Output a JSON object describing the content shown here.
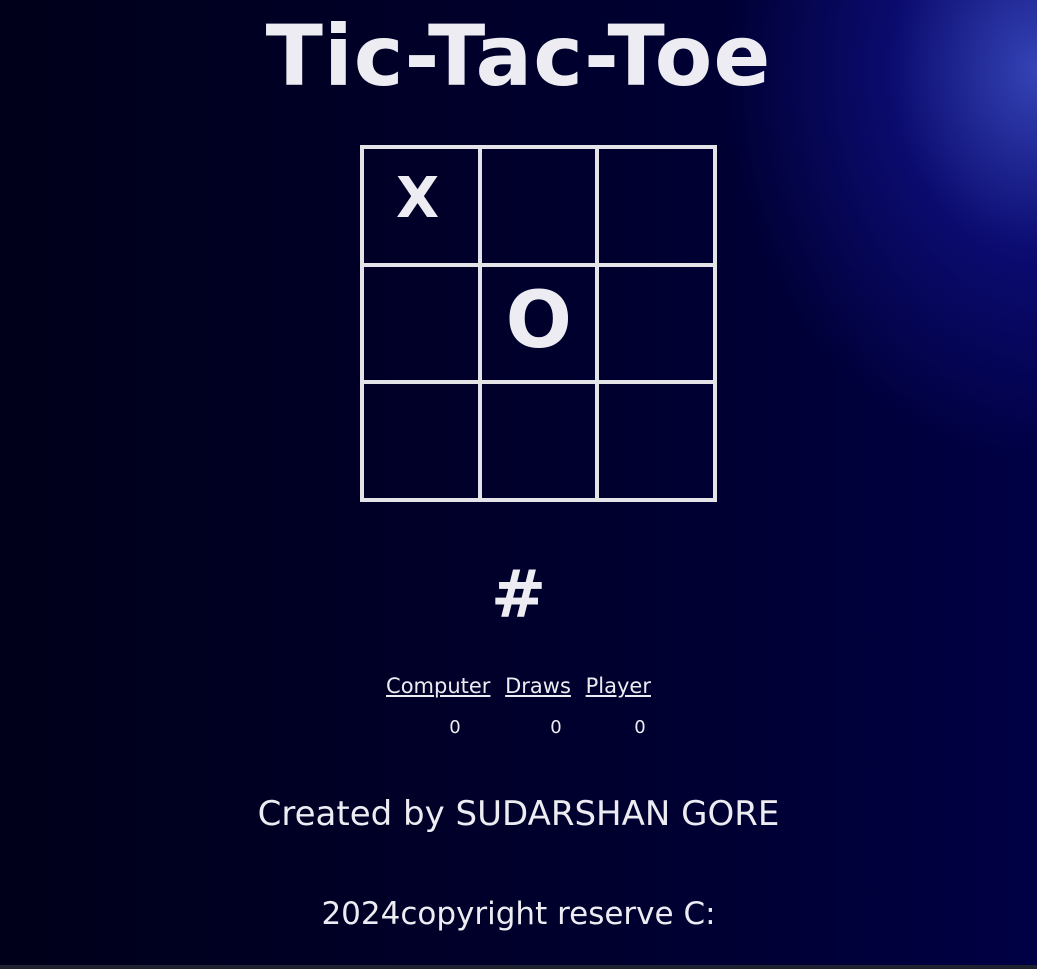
{
  "title": "Tic-Tac-Toe",
  "board": {
    "cells": [
      "X",
      "",
      "",
      "",
      "O",
      "",
      "",
      "",
      ""
    ]
  },
  "turn_indicator": "#",
  "scoreboard": {
    "computer_label": "Computer",
    "draws_label": "Draws",
    "player_label": "Player",
    "computer_score": "0",
    "draws_score": "0",
    "player_score": "0"
  },
  "footer": {
    "credit": "Created by SUDARSHAN GORE",
    "copyright": "2024copyright reserve C:"
  },
  "colors": {
    "background": "#000022",
    "foreground": "#ececf2",
    "accent_glow": "#2a35c0"
  }
}
